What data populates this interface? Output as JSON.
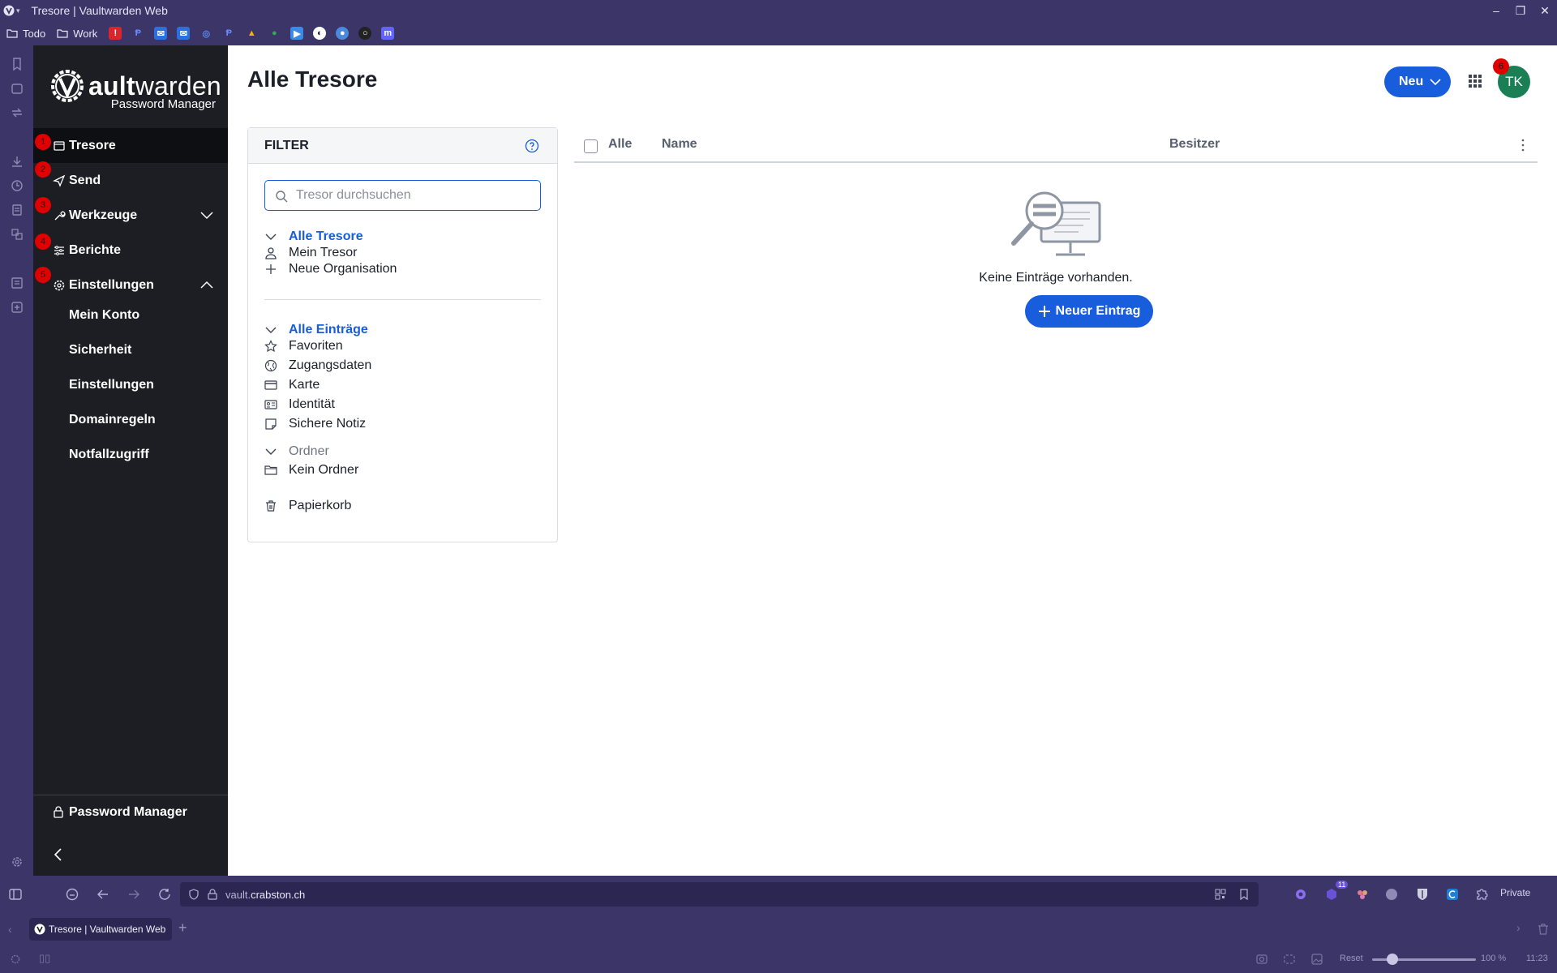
{
  "window": {
    "title": "Tresore | Vaultwarden Web",
    "controls": [
      "minimize",
      "maximize",
      "close"
    ]
  },
  "bookmarks": {
    "folders": [
      "Todo",
      "Work"
    ],
    "icons": [
      "alert-icon",
      "p-icon",
      "mail-icon",
      "mail-icon",
      "globe-icon",
      "p-icon",
      "drive-icon",
      "maps-icon",
      "play-icon",
      "github-icon",
      "circle-icon",
      "circle-icon",
      "mastodon-icon"
    ]
  },
  "sidebar": {
    "brand": {
      "word_light": "V",
      "word_bold": "ault",
      "word_rest": "warden",
      "subtitle": "Password Manager"
    },
    "items": [
      {
        "label": "Tresore",
        "badge": "1",
        "icon": "vault-icon"
      },
      {
        "label": "Send",
        "badge": "2",
        "icon": "send-icon"
      },
      {
        "label": "Werkzeuge",
        "badge": "3",
        "icon": "wrench-icon"
      },
      {
        "label": "Berichte",
        "badge": "4",
        "icon": "reports-icon"
      },
      {
        "label": "Einstellungen",
        "badge": "5",
        "icon": "gear-icon"
      }
    ],
    "sub_items": [
      "Mein Konto",
      "Sicherheit",
      "Einstellungen",
      "Domainregeln",
      "Notfallzugriff"
    ],
    "product_switcher": "Password Manager"
  },
  "header": {
    "title": "Alle Tresore",
    "new_label": "Neu",
    "avatar_initials": "TK",
    "avatar_badge": "6"
  },
  "filter": {
    "title": "FILTER",
    "search_placeholder": "Tresor durchsuchen",
    "vaults_header": "Alle Tresore",
    "vaults": [
      "Mein Tresor",
      "Neue Organisation"
    ],
    "items_header": "Alle Einträge",
    "types": [
      "Favoriten",
      "Zugangsdaten",
      "Karte",
      "Identität",
      "Sichere Notiz"
    ],
    "folders_header": "Ordner",
    "folders": [
      "Kein Ordner"
    ],
    "trash": "Papierkorb"
  },
  "table": {
    "col_all": "Alle",
    "col_name": "Name",
    "col_owner": "Besitzer",
    "empty_text": "Keine Einträge vorhanden.",
    "add_label": "Neuer Eintrag"
  },
  "browser": {
    "url_host_dim": "vault.",
    "url_host": "crabston.ch",
    "private_label": "Private",
    "tab_title": "Tresore | Vaultwarden Web",
    "extension_badge": "11",
    "zoom_reset": "Reset",
    "zoom_level": "100 %",
    "clock": "11:23"
  },
  "colors": {
    "accent": "#175ddc",
    "sidebar_bg": "#1c1e23",
    "browser_chrome": "#3b3568",
    "avatar": "#1a7f55",
    "badge": "#e00000"
  }
}
